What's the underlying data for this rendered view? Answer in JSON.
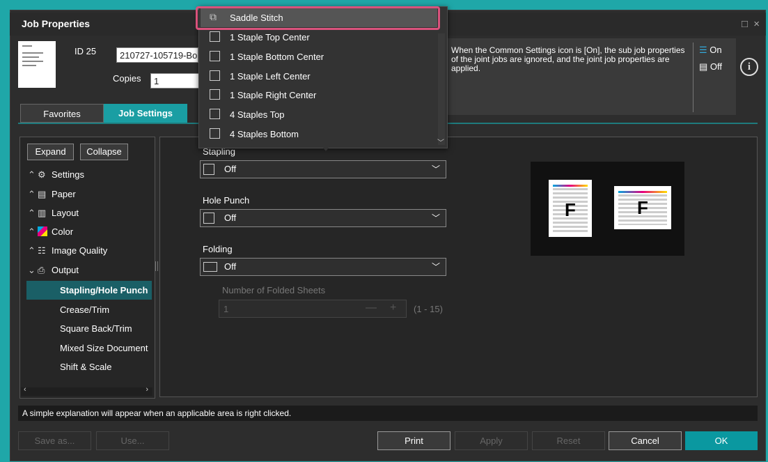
{
  "window": {
    "title": "Job Properties",
    "controls": "□ ×"
  },
  "header": {
    "id_label": "ID 25",
    "job_name": "210727-105719-Bo",
    "copies_label": "Copies",
    "copies_value": "1"
  },
  "tabs": [
    {
      "label": "Favorites"
    },
    {
      "label": "Job Settings"
    }
  ],
  "info": {
    "text": "When the Common Settings icon is [On], the sub job properties of the joint jobs are ignored, and the joint job properties are applied.",
    "on_label": "On",
    "off_label": "Off"
  },
  "tree": {
    "expand": "Expand",
    "collapse": "Collapse",
    "items": [
      {
        "label": "Settings",
        "icon": "gear-icon"
      },
      {
        "label": "Paper",
        "icon": "paper-icon"
      },
      {
        "label": "Layout",
        "icon": "layout-icon"
      },
      {
        "label": "Color",
        "icon": "color-icon"
      },
      {
        "label": "Image Quality",
        "icon": "image-quality-icon"
      },
      {
        "label": "Output",
        "icon": "printer-icon"
      }
    ],
    "sub_items": [
      {
        "label": "Stapling/Hole Punch"
      },
      {
        "label": "Crease/Trim"
      },
      {
        "label": "Square Back/Trim"
      },
      {
        "label": "Mixed Size Document"
      },
      {
        "label": "Shift & Scale"
      }
    ]
  },
  "main": {
    "stapling_label": "Stapling",
    "stapling_value": "Off",
    "hole_punch_label": "Hole Punch",
    "hole_punch_value": "Off",
    "folding_label": "Folding",
    "folding_value": "Off",
    "folded_sheets_label": "Number of Folded Sheets",
    "folded_sheets_value": "1",
    "folded_sheets_range": "(1 - 15)"
  },
  "menu": {
    "items": [
      {
        "label": "Saddle Stitch"
      },
      {
        "label": "1 Staple Top Center"
      },
      {
        "label": "1 Staple Bottom Center"
      },
      {
        "label": "1 Staple Left Center"
      },
      {
        "label": "1 Staple Right Center"
      },
      {
        "label": "4 Staples Top"
      },
      {
        "label": "4 Staples Bottom"
      }
    ]
  },
  "preview": {
    "letter": "F"
  },
  "status": "A simple explanation will appear when an applicable area is right clicked.",
  "footer": {
    "save_as": "Save as...",
    "use": "Use...",
    "print": "Print",
    "apply": "Apply",
    "reset": "Reset",
    "cancel": "Cancel",
    "ok": "OK"
  },
  "colors": {
    "accent": "#1a9ea3",
    "highlight": "#d9527c",
    "ok_button": "#0a98a0"
  }
}
